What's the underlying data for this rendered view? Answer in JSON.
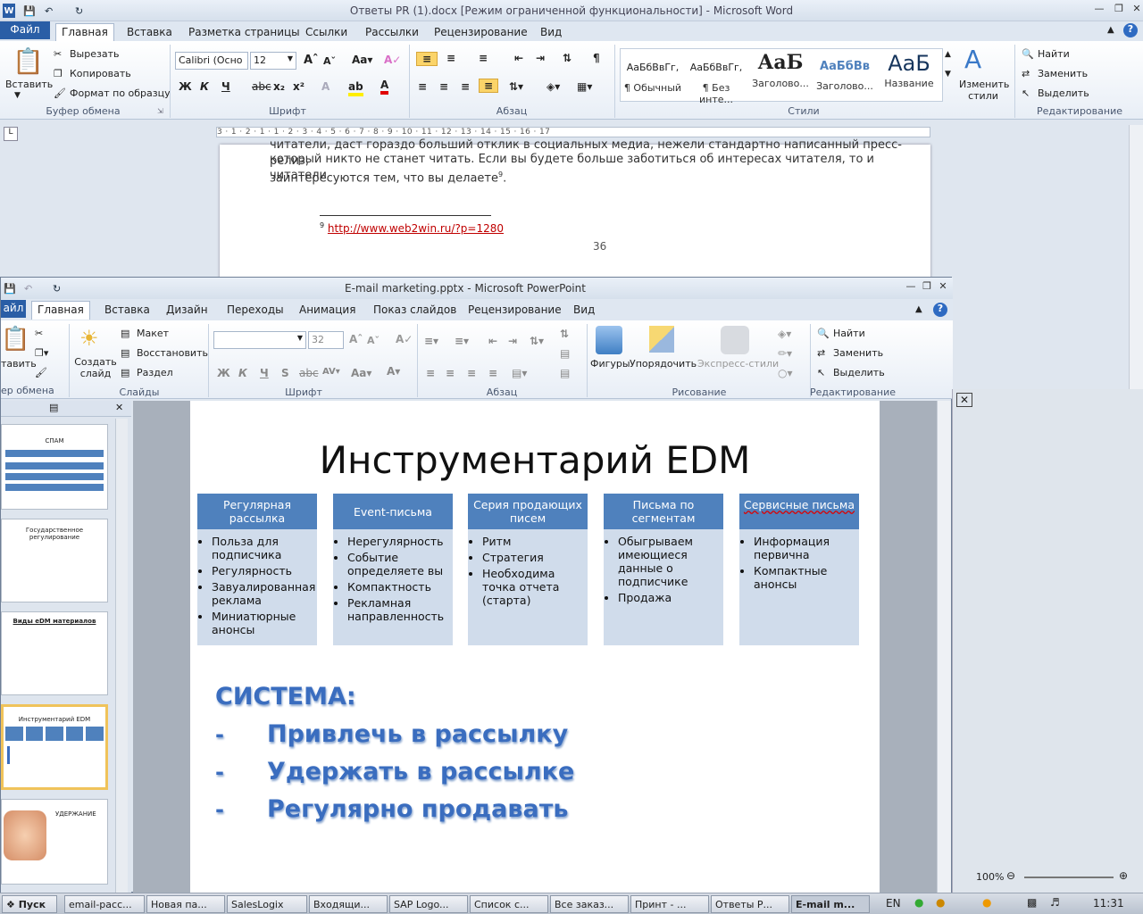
{
  "word": {
    "title": "Ответы PR (1).docx [Режим ограниченной функциональности]  -  Microsoft Word",
    "tabs": [
      "Файл",
      "Главная",
      "Вставка",
      "Разметка страницы",
      "Ссылки",
      "Рассылки",
      "Рецензирование",
      "Вид"
    ],
    "clipboard": {
      "paste": "Вставить",
      "cut": "Вырезать",
      "copy": "Копировать",
      "format": "Формат по образцу",
      "group": "Буфер обмена"
    },
    "font": {
      "name": "Calibri (Осно",
      "size": "12",
      "group": "Шрифт"
    },
    "paragraph_group": "Абзац",
    "styles": [
      {
        "sample": "АаБбВвГг,",
        "name": "¶ Обычный"
      },
      {
        "sample": "АаБбВвГг,",
        "name": "¶ Без инте..."
      },
      {
        "sample": "АаБ",
        "name": "Заголово..."
      },
      {
        "sample": "АаБбВв",
        "name": "Заголово..."
      },
      {
        "sample": "АаБ",
        "name": "Название"
      }
    ],
    "styles_group": "Стили",
    "change_styles": "Изменить стили",
    "editing": {
      "find": "Найти",
      "replace": "Заменить",
      "select": "Выделить",
      "group": "Редактирование"
    },
    "ruler": "3 · 1 · 2 · 1 · 1 · 2 · 3 · 4 · 5 · 6 · 7 · 8 · 9 · 10 · 11 · 12 · 13 · 14 · 15 · 16 · 17",
    "doc_lines": [
      "читатели, даст гораздо больший отклик в социальных медиа, нежели стандартно написанный пресс-релиз,",
      "который никто не станет читать. Если вы будете больше заботиться об интересах читателя, то и читатели",
      "заинтересуются тем, что вы делаете"
    ],
    "footnote_sup": "9",
    "footnote_num": "9",
    "footnote_link": "http://www.web2win.ru/?p=1280",
    "page_number": "36"
  },
  "ppt": {
    "title": "E-mail marketing.pptx  -  Microsoft PowerPoint",
    "tabs": [
      "айл",
      "Главная",
      "Вставка",
      "Дизайн",
      "Переходы",
      "Анимация",
      "Показ слайдов",
      "Рецензирование",
      "Вид"
    ],
    "clip": {
      "paste": "тавить",
      "group": "ер обмена"
    },
    "slides": {
      "new": "Создать слайд",
      "layout": "Макет",
      "reset": "Восстановить",
      "section": "Раздел",
      "group": "Слайды"
    },
    "font": {
      "size": "32",
      "group": "Шрифт"
    },
    "para_group": "Абзац",
    "drawing": {
      "shapes": "Фигуры",
      "arrange": "Упорядочить",
      "quick": "Экспресс-стили",
      "group": "Рисование"
    },
    "editing": {
      "find": "Найти",
      "replace": "Заменить",
      "select": "Выделить",
      "group": "Редактирование"
    },
    "thumbs": [
      {
        "title": "СПАМ"
      },
      {
        "title": "Государственное регулирование"
      },
      {
        "title": "Виды eDM материалов"
      },
      {
        "title": "Инструментарий  EDM"
      },
      {
        "title": "УДЕРЖАНИЕ"
      }
    ],
    "slide": {
      "title": "Инструментарий EDM",
      "columns": [
        {
          "head": "Регулярная рассылка",
          "items": [
            "Польза для подписчика",
            "Регулярность",
            "Завуалированная реклама",
            "Миниатюрные анонсы"
          ]
        },
        {
          "head": "Event-письма",
          "items": [
            "Нерегулярность",
            "Событие определяете вы",
            "Компактность",
            "Рекламная направленность"
          ]
        },
        {
          "head": "Серия продающих писем",
          "items": [
            "Ритм",
            "Стратегия",
            "Необходима точка отчета (старта)"
          ]
        },
        {
          "head": "Письма по сегментам",
          "items": [
            "Обыгрываем имеющиеся данные о подписчике",
            "Продажа"
          ]
        },
        {
          "head": "Сервисные письма",
          "items": [
            "Информация первична",
            "Компактные анонсы"
          ]
        }
      ],
      "system": "СИСТЕМА:",
      "bullets": [
        "Привлечь в рассылку",
        "Удержать в рассылке",
        "Регулярно продавать"
      ],
      "dash": "-"
    }
  },
  "statusbar": {
    "zoom": "100%"
  },
  "taskbar": {
    "start": "Пуск",
    "items": [
      "email-расс...",
      "Новая па...",
      "SalesLogix",
      "Входящи...",
      "SAP Logo...",
      "Список с...",
      "Все заказ...",
      "Принт - ...",
      "Ответы Р...",
      "E-mail m..."
    ],
    "lang": "EN",
    "time": "11:31"
  }
}
